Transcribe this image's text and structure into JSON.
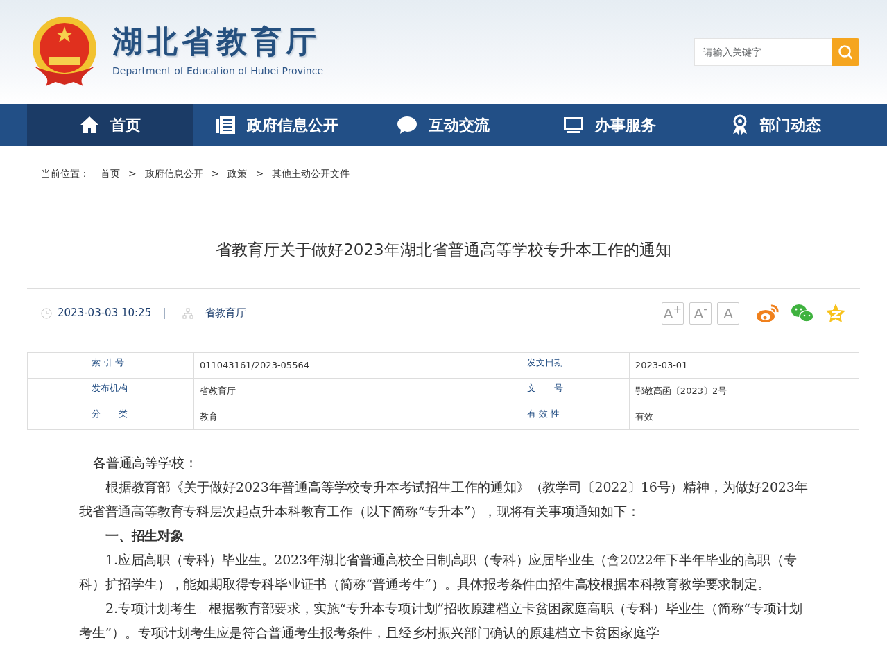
{
  "header": {
    "title": "湖北省教育厅",
    "subtitle": "Department of Education of Hubei Province",
    "search": {
      "placeholder": "请输入关键字"
    }
  },
  "nav": [
    {
      "label": "首页",
      "selected": true
    },
    {
      "label": "政府信息公开",
      "selected": false
    },
    {
      "label": "互动交流",
      "selected": false
    },
    {
      "label": "办事服务",
      "selected": false
    },
    {
      "label": "部门动态",
      "selected": false
    }
  ],
  "breadcrumb": {
    "label": "当前位置：",
    "items": [
      "首页",
      "政府信息公开",
      "政策",
      "其他主动公开文件"
    ],
    "separator": ">"
  },
  "article": {
    "title": "省教育厅关于做好2023年湖北省普通高等学校专升本工作的通知",
    "date": "2023-03-03 10:25",
    "separator": "|",
    "source": "省教育厅",
    "font_buttons": [
      "A$^{+}$",
      "A$^{-}$",
      "A"
    ],
    "meta": [
      {
        "label": "索 引 号",
        "value": "011043161/2023-05564",
        "label2": "发文日期",
        "value2": "2023-03-01"
      },
      {
        "label": "发布机构",
        "value": "省教育厅",
        "label2": "文　　号",
        "value2": "鄂教高函〔2023〕2号"
      },
      {
        "label": "分　　类",
        "value": "教育",
        "label2": "有 效 性",
        "value2": "有效"
      }
    ],
    "paragraphs": [
      {
        "kind": "salutation",
        "text": "各普通高等学校："
      },
      {
        "kind": "text",
        "text": "根据教育部《关于做好2023年普通高等学校专升本考试招生工作的通知》（教学司〔2022〕16号）精神，为做好2023年我省普通高等教育专科层次起点升本科教育工作（以下简称“专升本”），现将有关事项通知如下："
      },
      {
        "kind": "heading",
        "text": "一、招生对象"
      },
      {
        "kind": "text",
        "text": "1.应届高职（专科）毕业生。2023年湖北省普通高校全日制高职（专科）应届毕业生（含2022年下半年毕业的高职（专科）扩招学生），能如期取得专科毕业证书（简称“普通考生”）。具体报考条件由招生高校根据本科教育教学要求制定。"
      },
      {
        "kind": "text",
        "text": "2.专项计划考生。根据教育部要求，实施“专升本专项计划”招收原建档立卡贫困家庭高职（专科）毕业生（简称“专项计划考生”）。专项计划考生应是符合普通考生报考条件，且经乡村振兴部门确认的原建档立卡贫困家庭学"
      }
    ]
  }
}
